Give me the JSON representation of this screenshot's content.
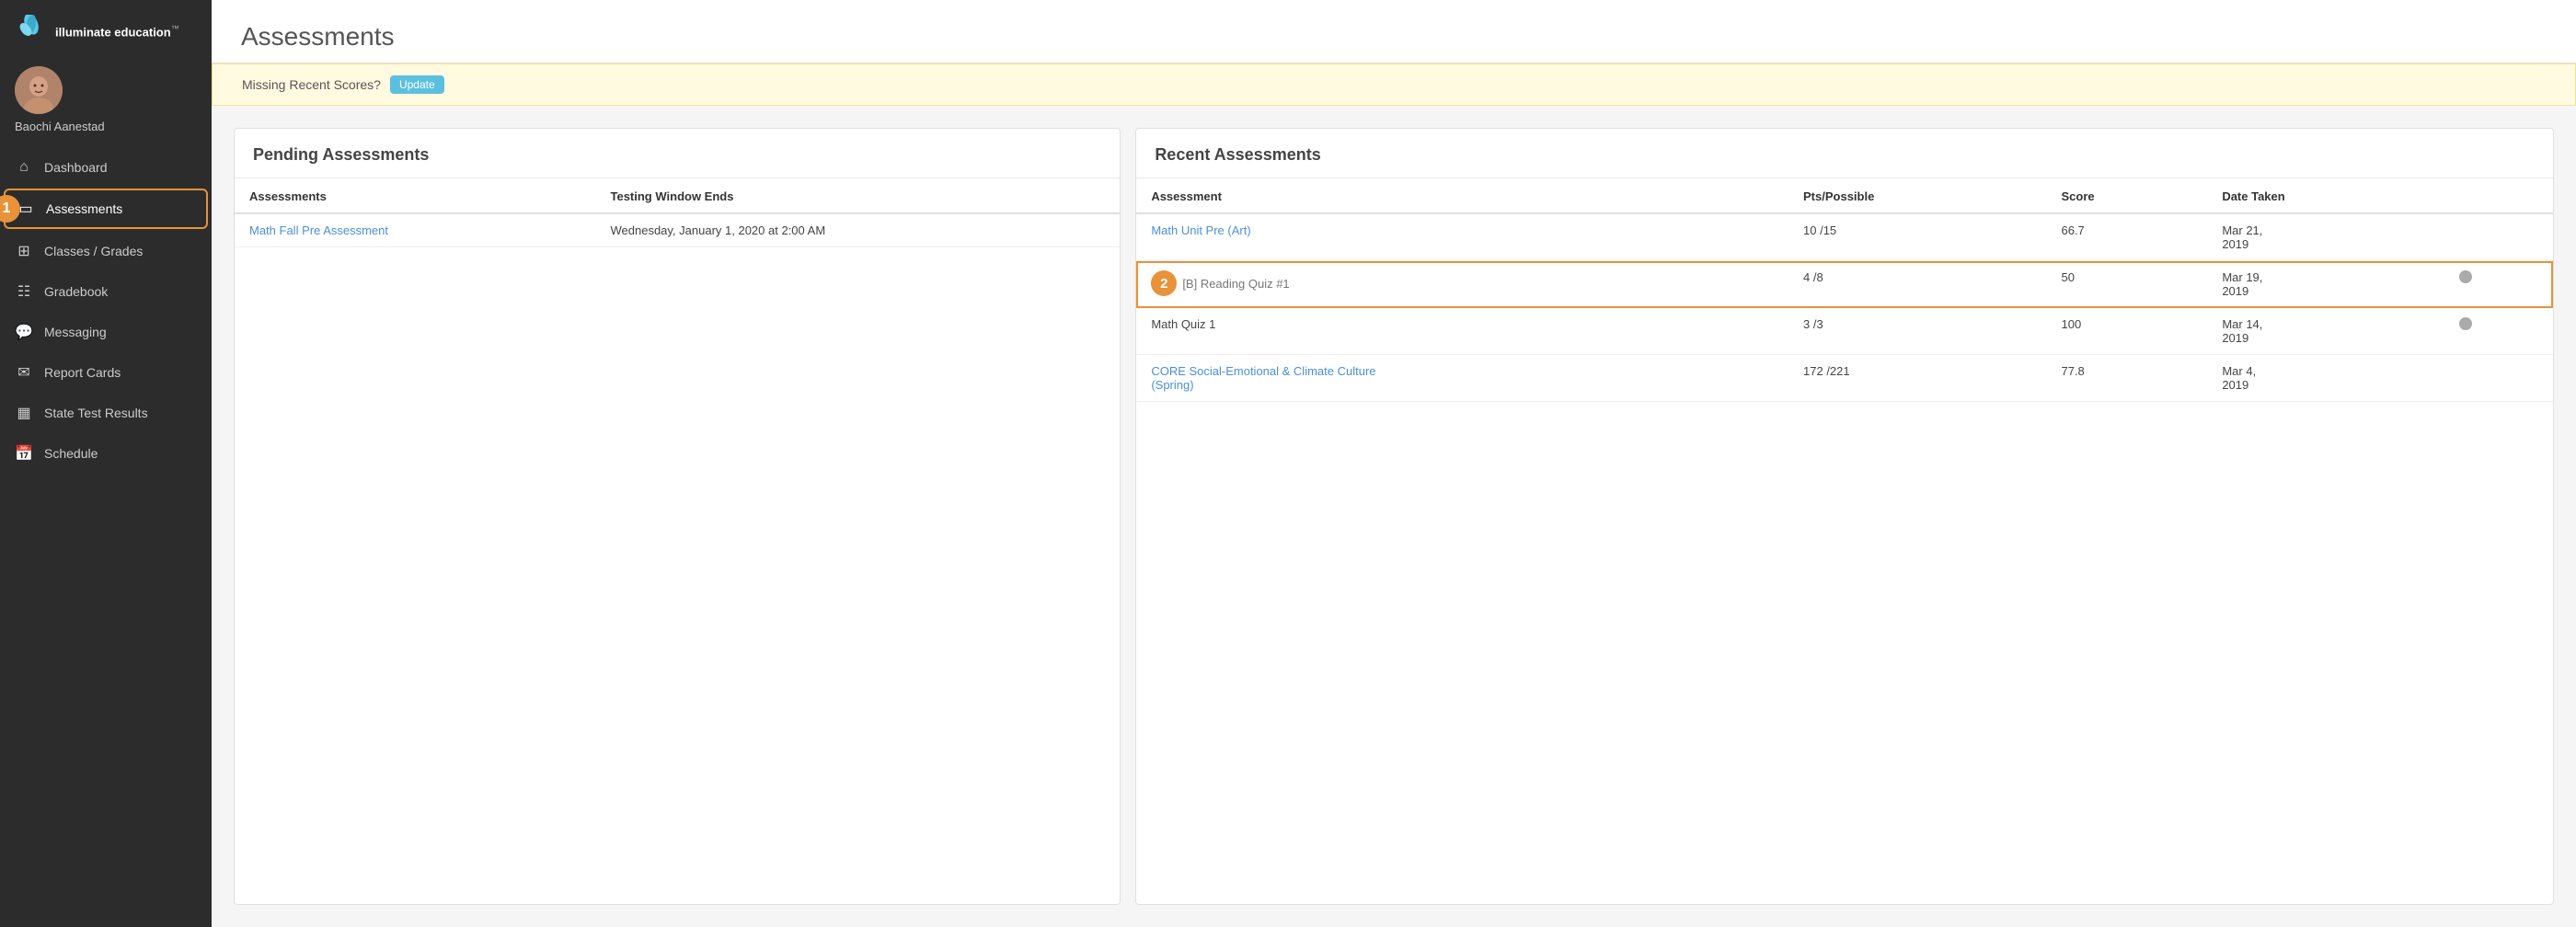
{
  "app": {
    "logo_text": "illuminate education",
    "logo_tm": "™"
  },
  "user": {
    "name": "Baochi Aanestad"
  },
  "sidebar": {
    "items": [
      {
        "id": "dashboard",
        "label": "Dashboard",
        "icon": "⌂",
        "active": false
      },
      {
        "id": "assessments",
        "label": "Assessments",
        "icon": "▭",
        "active": true
      },
      {
        "id": "classes-grades",
        "label": "Classes / Grades",
        "icon": "⊞",
        "active": false
      },
      {
        "id": "gradebook",
        "label": "Gradebook",
        "icon": "☷",
        "active": false
      },
      {
        "id": "messaging",
        "label": "Messaging",
        "icon": "☉",
        "active": false
      },
      {
        "id": "report-cards",
        "label": "Report Cards",
        "icon": "✉",
        "active": false
      },
      {
        "id": "state-test-results",
        "label": "State Test Results",
        "icon": "▦",
        "active": false
      },
      {
        "id": "schedule",
        "label": "Schedule",
        "icon": "📅",
        "active": false
      }
    ]
  },
  "page": {
    "title": "Assessments"
  },
  "notice": {
    "text": "Missing Recent Scores?",
    "button_label": "Update"
  },
  "pending_panel": {
    "title": "Pending Assessments",
    "columns": [
      "Assessments",
      "Testing Window Ends"
    ],
    "rows": [
      {
        "assessment": "Math Fall Pre Assessment",
        "window_ends": "Wednesday, January 1, 2020 at 2:00 AM"
      }
    ]
  },
  "recent_panel": {
    "title": "Recent Assessments",
    "columns": [
      "Assessment",
      "Pts/Possible",
      "Score",
      "Date Taken"
    ],
    "rows": [
      {
        "assessment": "Math Unit Pre (Art)",
        "pts_possible": "10 /15",
        "score": "66.7",
        "date_taken": "Mar 21, 2019",
        "link": true,
        "highlighted": false,
        "has_icon": false
      },
      {
        "assessment": "[B] Reading Quiz #1",
        "pts_possible": "4 /8",
        "score": "50",
        "date_taken": "Mar 19, 2019",
        "link": false,
        "highlighted": true,
        "has_icon": true
      },
      {
        "assessment": "Math Quiz 1",
        "pts_possible": "3 /3",
        "score": "100",
        "date_taken": "Mar 14, 2019",
        "link": false,
        "highlighted": false,
        "has_icon": true
      },
      {
        "assessment": "CORE Social-Emotional & Climate Culture (Spring)",
        "pts_possible": "172 /221",
        "score": "77.8",
        "date_taken": "Mar 4, 2019",
        "link": true,
        "highlighted": false,
        "has_icon": false
      }
    ]
  },
  "annotations": {
    "step1": "1",
    "step2": "2"
  }
}
